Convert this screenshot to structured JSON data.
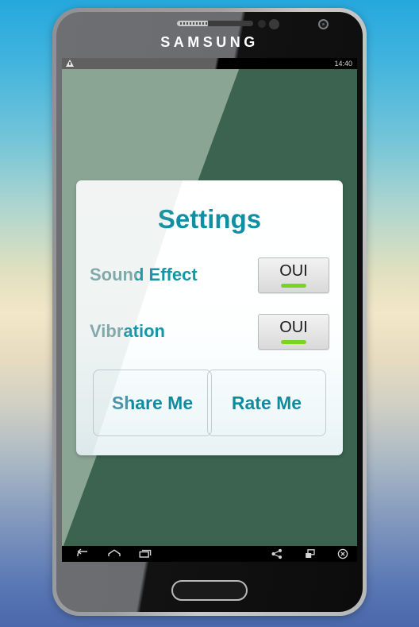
{
  "device": {
    "brand": "SAMSUNG",
    "home_button": "home-button"
  },
  "status_bar": {
    "warning_icon": "warning-triangle-icon",
    "time": "14:40"
  },
  "dialog": {
    "title": "Settings",
    "rows": [
      {
        "label": "Sound Effect",
        "toggle_value": "OUI",
        "toggle_state_color": "#7ed321"
      },
      {
        "label": "Vibration",
        "toggle_value": "OUI",
        "toggle_state_color": "#7ed321"
      }
    ],
    "buttons": [
      {
        "label": "Share Me"
      },
      {
        "label": "Rate Me"
      }
    ]
  },
  "nav_bar": {
    "items": [
      {
        "name": "back-icon"
      },
      {
        "name": "home-icon"
      },
      {
        "name": "recents-icon"
      },
      {
        "name": "share-icon"
      },
      {
        "name": "multi-window-icon"
      },
      {
        "name": "close-icon"
      }
    ]
  },
  "theme": {
    "accent_teal": "#0f8ba0",
    "light_teal": "#7fa8ad",
    "app_bg_dark": "#3b6350",
    "app_bg_light": "#8ba595",
    "toggle_green": "#7ed321"
  }
}
